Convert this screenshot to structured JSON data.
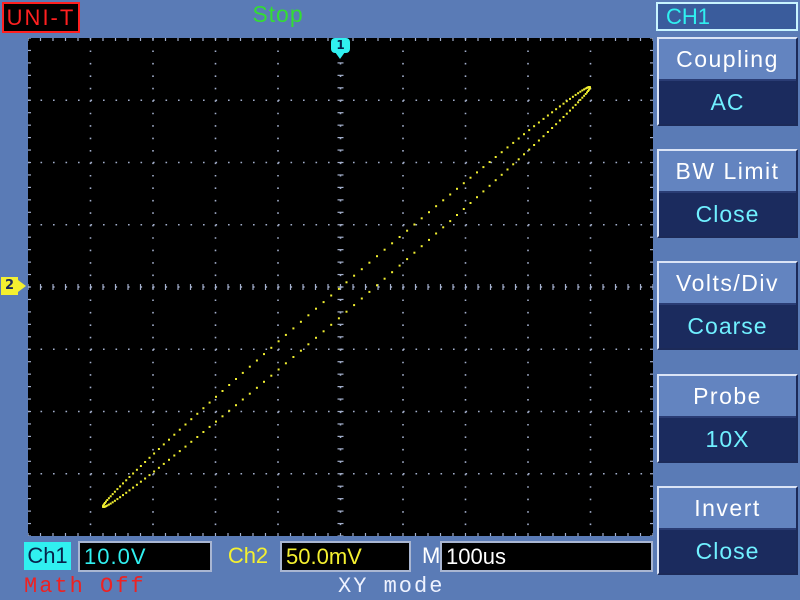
{
  "header": {
    "brand": "UNI-T",
    "run_state": "Stop"
  },
  "markers": {
    "ch1_position": "1",
    "ch2_position": "2"
  },
  "menu": {
    "title": "CH1",
    "items": [
      {
        "label": "Coupling",
        "value": "AC"
      },
      {
        "label": "BW Limit",
        "value": "Close"
      },
      {
        "label": "Volts/Div",
        "value": "Coarse"
      },
      {
        "label": "Probe",
        "value": "10X"
      },
      {
        "label": "Invert",
        "value": "Close"
      }
    ]
  },
  "readouts": {
    "ch1_label": "Ch1",
    "ch1_volts_div": "10.0V",
    "ch2_label": "Ch2",
    "ch2_volts_div": "50.0mV",
    "timebase_label": "M",
    "timebase": "100us"
  },
  "footer": {
    "math": "Math Off",
    "display_mode": "XY mode"
  },
  "colors": {
    "background": "#5a7bb6",
    "brand": "#ff2020",
    "run_state": "#33dd33",
    "ch1": "#30f0f0",
    "ch2": "#f4f030",
    "trace": "#f0ee30",
    "graticule": "#a2aecb",
    "math": "#ee2222",
    "menu_label_bg": "#6384c0",
    "menu_value_bg": "#1b2b5e",
    "menu_value_text": "#70f0ff"
  }
}
